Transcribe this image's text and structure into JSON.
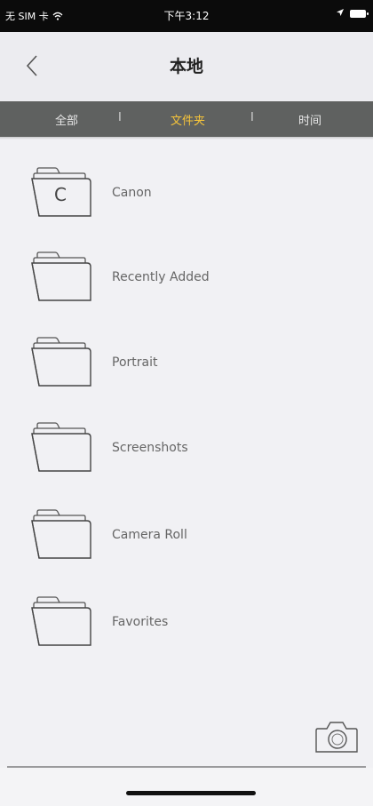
{
  "status_bar": {
    "carrier": "无 SIM 卡",
    "time": "下午3:12",
    "icons": [
      "wifi-icon",
      "location-arrow-icon",
      "battery-icon"
    ]
  },
  "nav": {
    "back_icon": "chevron-left-icon",
    "title": "本地"
  },
  "filter": {
    "tabs": [
      {
        "label": "全部",
        "active": false
      },
      {
        "label": "文件夹",
        "active": true
      },
      {
        "label": "时间",
        "active": false
      }
    ],
    "separator": "I",
    "active_color": "#f6c43a"
  },
  "folders": [
    {
      "name": "Canon",
      "letter": "C",
      "icon": "folder-icon"
    },
    {
      "name": "Recently Added",
      "letter": "",
      "icon": "folder-icon"
    },
    {
      "name": "Portrait",
      "letter": "",
      "icon": "folder-icon"
    },
    {
      "name": "Screenshots",
      "letter": "",
      "icon": "folder-icon"
    },
    {
      "name": "Camera Roll",
      "letter": "",
      "icon": "folder-icon"
    },
    {
      "name": "Favorites",
      "letter": "",
      "icon": "folder-icon"
    }
  ],
  "camera_icon": "camera-icon"
}
